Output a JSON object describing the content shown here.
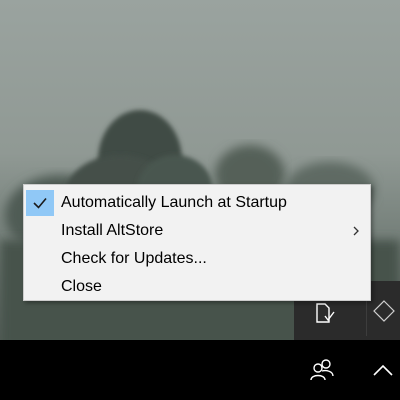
{
  "context_menu": {
    "items": [
      {
        "label": "Automatically Launch at Startup",
        "checked": true
      },
      {
        "label": "Install AltStore",
        "has_submenu": true
      },
      {
        "label": "Check for Updates..."
      },
      {
        "label": "Close"
      }
    ],
    "check_highlight_color": "#90c8f6"
  },
  "taskbar": {
    "tray_icons": [
      "people-icon",
      "show-hidden-icons-chevron-icon"
    ]
  },
  "tray_overflow": {
    "icons": [
      "altstore-tray-icon",
      "diamond-tray-icon"
    ]
  }
}
